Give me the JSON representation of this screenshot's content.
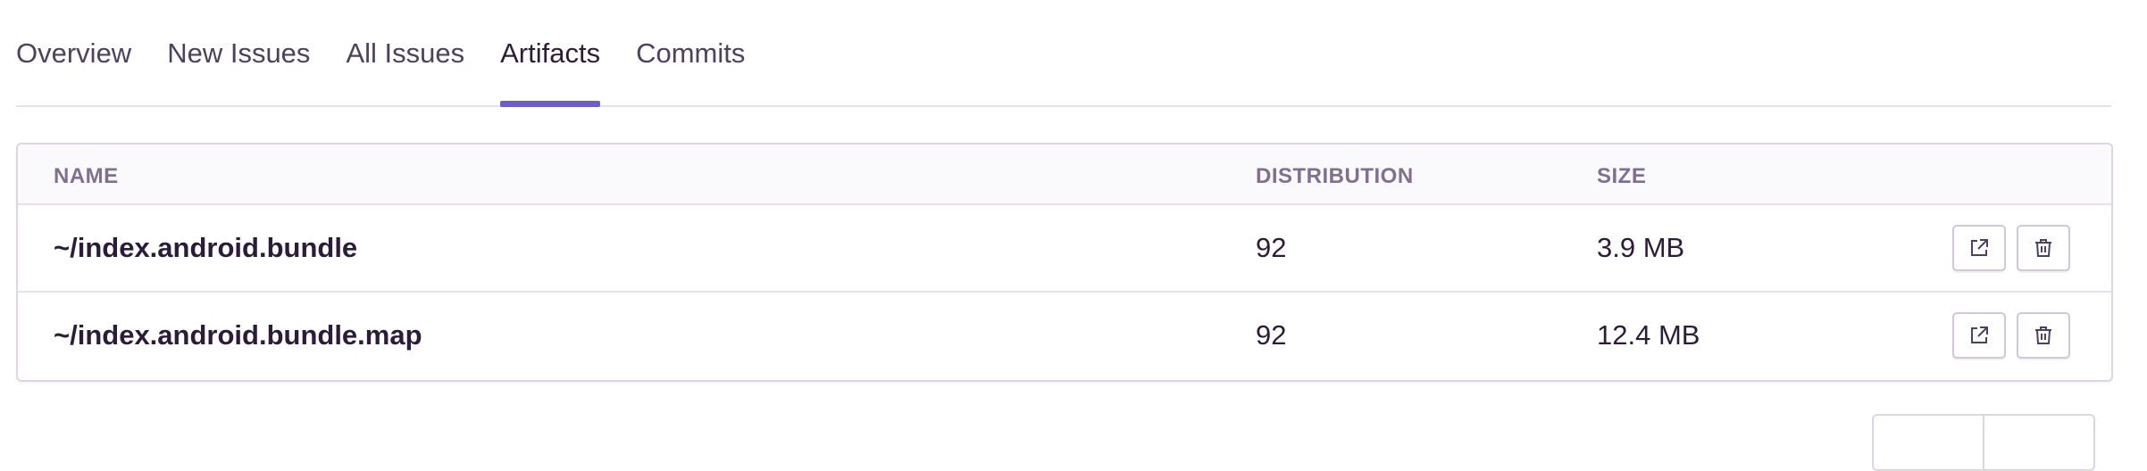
{
  "tabs": [
    {
      "label": "Overview"
    },
    {
      "label": "New Issues"
    },
    {
      "label": "All Issues"
    },
    {
      "label": "Artifacts",
      "active": true
    },
    {
      "label": "Commits"
    }
  ],
  "table": {
    "headers": {
      "name": "NAME",
      "distribution": "DISTRIBUTION",
      "size": "SIZE"
    },
    "rows": [
      {
        "name": "~/index.android.bundle",
        "distribution": "92",
        "size": "3.9 MB"
      },
      {
        "name": "~/index.android.bundle.map",
        "distribution": "92",
        "size": "12.4 MB"
      }
    ]
  },
  "colors": {
    "accent": "#6c5fc7",
    "header_text": "#80708f",
    "border": "#dcd6e3"
  },
  "icons": {
    "open": "external-link-icon",
    "delete": "trash-icon"
  }
}
